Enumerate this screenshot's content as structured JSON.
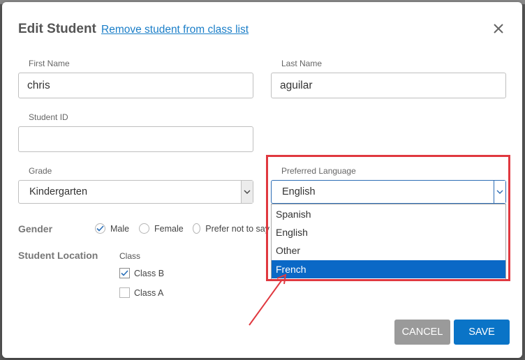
{
  "modal": {
    "title": "Edit Student",
    "remove_link": "Remove student from class list",
    "close_icon": "close-icon"
  },
  "fields": {
    "first_name": {
      "label": "First Name",
      "value": "chris"
    },
    "last_name": {
      "label": "Last Name",
      "value": "aguilar"
    },
    "student_id": {
      "label": "Student ID",
      "value": ""
    },
    "grade": {
      "label": "Grade",
      "value": "Kindergarten"
    },
    "preferred_language": {
      "label": "Preferred Language",
      "value": "English",
      "options": [
        "Spanish",
        "English",
        "Other",
        "French"
      ],
      "highlighted_option": "French"
    }
  },
  "gender": {
    "label": "Gender",
    "options": [
      "Male",
      "Female",
      "Prefer not to say"
    ],
    "selected": "Male"
  },
  "location": {
    "label": "Student Location",
    "class_header": "Class",
    "classes": [
      {
        "label": "Class B",
        "checked": true
      },
      {
        "label": "Class A",
        "checked": false
      }
    ]
  },
  "actions": {
    "cancel_label": "CANCEL",
    "save_label": "SAVE"
  },
  "colors": {
    "accent": "#0a74c7",
    "link": "#1a7ec8",
    "annotation": "#e0383f",
    "cancel": "#9a9a9a"
  }
}
